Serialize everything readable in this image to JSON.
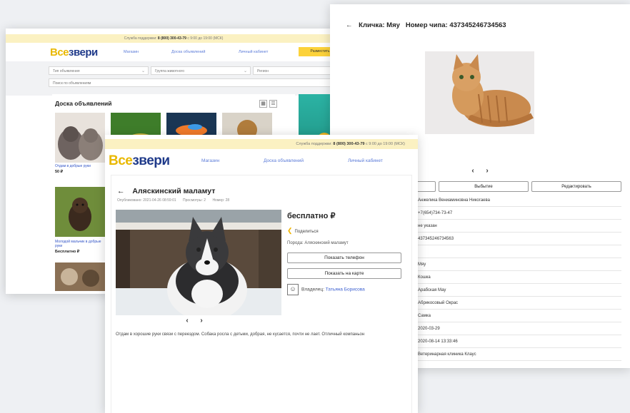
{
  "support": {
    "label": "Служба поддержки:",
    "phone": "8 (800) 300-43-79",
    "hours": "с 9:00 до 19:00 (МСК)"
  },
  "logo": {
    "part1": "Все",
    "part2": "звери"
  },
  "nav": [
    "Магазин",
    "Доска объявлений",
    "Личный кабинет"
  ],
  "back_card": {
    "header_button": "Разместить",
    "filters": {
      "type": "Тип объявления",
      "group": "Группа животного",
      "city": "Регион",
      "search_placeholder": "Поиск по объявлениям"
    },
    "board_title": "Доска объявлений",
    "grid_icon": "grid-icon",
    "list_icon": "list-icon",
    "items": [
      {
        "caption": "Отдам в добрые руки",
        "price": "50 ₽"
      },
      {
        "caption": "Молодой мальчик в добрые руки",
        "price": "Бесплатно ₽"
      }
    ]
  },
  "pet_card": {
    "back_arrow": "←",
    "nickname": "Кличка: Мяу",
    "chip": "Номер чипа: 437345246734563",
    "buttons": [
      "Выбытие",
      "Редактировать"
    ],
    "rows": [
      "Анжелика Вениаминовна Никогаева",
      "+7(654)734-73-47",
      "не указан",
      "437345246734563",
      "",
      "Мяу",
      "Кошка",
      "Арабская Мау",
      "Абрикосовый Окрас",
      "Самка",
      "2020-03-29",
      "2020-08-14 13:33:46",
      "Ветеринарная клиника Клаус"
    ]
  },
  "ad": {
    "back_arrow": "←",
    "title": "Аляскинский маламут",
    "meta": {
      "published": "Опубликовано: 2021-04-26 08:59:01",
      "views": "Просмотры: 2",
      "number": "Номер: 28"
    },
    "price": "бесплатно ₽",
    "share": "Поделиться",
    "breed": "Порода: Аляскинский маламут",
    "show_phone": "Показать телефон",
    "show_map": "Показать на карте",
    "owner_label": "Владелец:",
    "owner_name": "Татьяна Борисова",
    "description": "Отдам в хорошие руки связи с переездом. Собака росла с детьми, добрая, не кусается, почти не лает. Отличный компаньон"
  },
  "colors": {
    "accent_yellow": "#fcd23a",
    "link_blue": "#3b5fd0",
    "logo_blue": "#1f3a8a",
    "support_bg": "#fbf1c2"
  }
}
